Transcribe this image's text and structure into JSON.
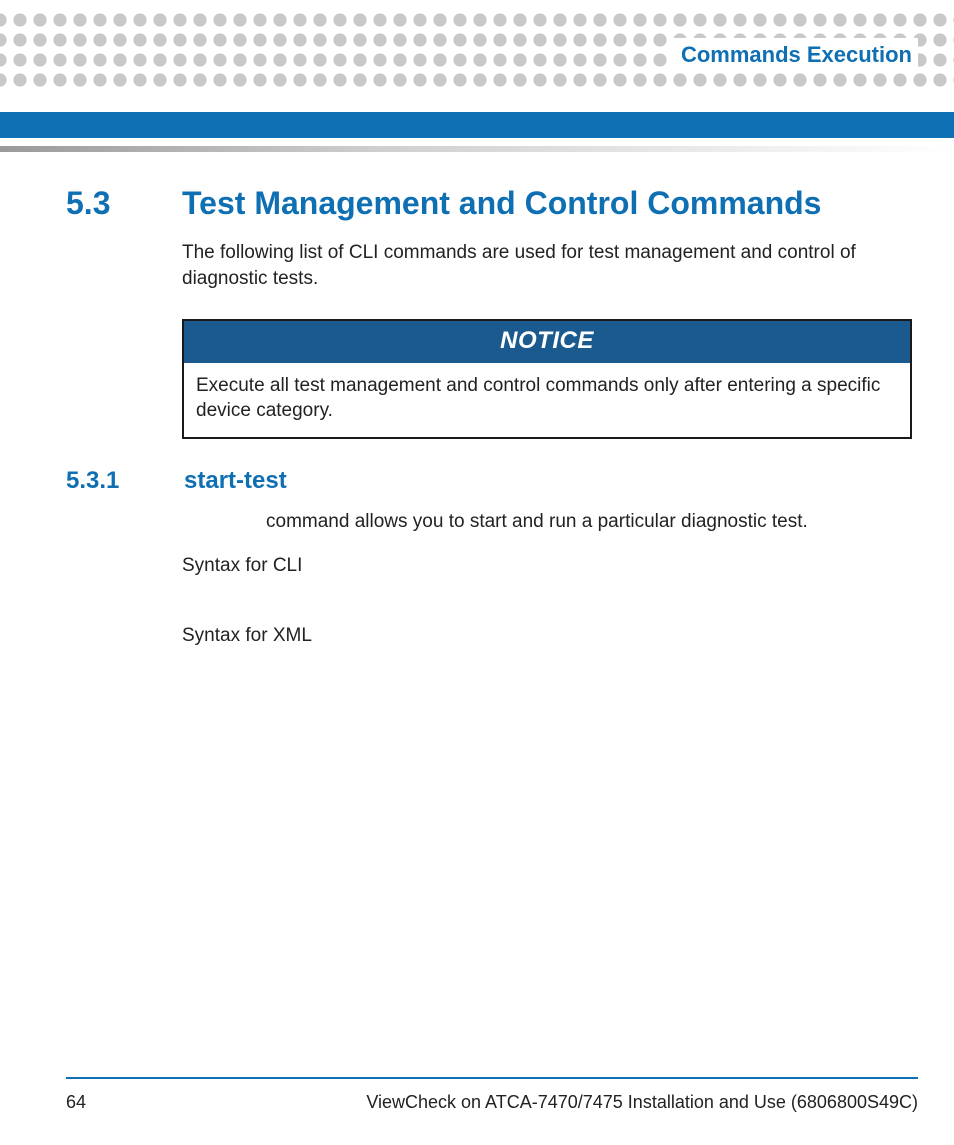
{
  "header": {
    "running_title": "Commands Execution"
  },
  "section": {
    "number": "5.3",
    "title": "Test Management and Control Commands",
    "intro": "The following list of CLI commands are used for test management and control of diagnostic tests."
  },
  "notice": {
    "label": "NOTICE",
    "text": "Execute all test management and control commands only after entering a specific device category."
  },
  "subsection": {
    "number": "5.3.1",
    "title": "start-test",
    "desc_fragment": "command allows you to start and run a particular diagnostic test.",
    "syntax_cli_label": "Syntax for CLI",
    "syntax_xml_label": "Syntax for XML"
  },
  "footer": {
    "page_number": "64",
    "doc_title": "ViewCheck on ATCA-7470/7475 Installation and Use (6806800S49C)"
  }
}
